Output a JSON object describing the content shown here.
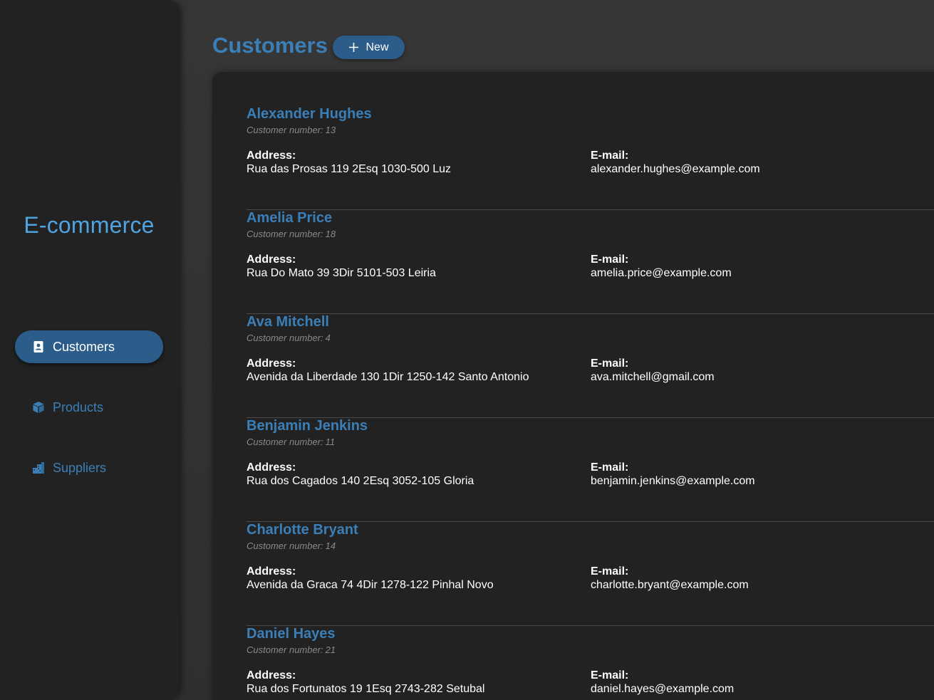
{
  "app": {
    "brand": "E-commerce",
    "accent_color": "#3b7fb8",
    "brand_color": "#4fa3e0"
  },
  "sidebar": {
    "items": [
      {
        "label": "Customers",
        "icon": "contact-card-icon",
        "active": true
      },
      {
        "label": "Products",
        "icon": "box-icon",
        "active": false
      },
      {
        "label": "Suppliers",
        "icon": "buildings-icon",
        "active": false
      }
    ]
  },
  "header": {
    "title": "Customers",
    "new_label": "New"
  },
  "labels": {
    "customer_number": "Customer number:",
    "address": "Address:",
    "email": "E-mail:"
  },
  "customers": [
    {
      "name": "Alexander Hughes",
      "number": "13",
      "address": "Rua das Prosas 119 2Esq 1030-500 Luz",
      "email": "alexander.hughes@example.com"
    },
    {
      "name": "Amelia Price",
      "number": "18",
      "address": "Rua Do Mato 39 3Dir 5101-503 Leiria",
      "email": "amelia.price@example.com"
    },
    {
      "name": "Ava Mitchell",
      "number": "4",
      "address": "Avenida da Liberdade 130 1Dir 1250-142 Santo Antonio",
      "email": "ava.mitchell@gmail.com"
    },
    {
      "name": "Benjamin Jenkins",
      "number": "11",
      "address": "Rua dos Cagados 140 2Esq 3052-105 Gloria",
      "email": "benjamin.jenkins@example.com"
    },
    {
      "name": "Charlotte Bryant",
      "number": "14",
      "address": "Avenida da Graca 74 4Dir 1278-122 Pinhal Novo",
      "email": "charlotte.bryant@example.com"
    },
    {
      "name": "Daniel Hayes",
      "number": "21",
      "address": "Rua dos Fortunatos 19 1Esq 2743-282 Setubal",
      "email": "daniel.hayes@example.com"
    }
  ]
}
